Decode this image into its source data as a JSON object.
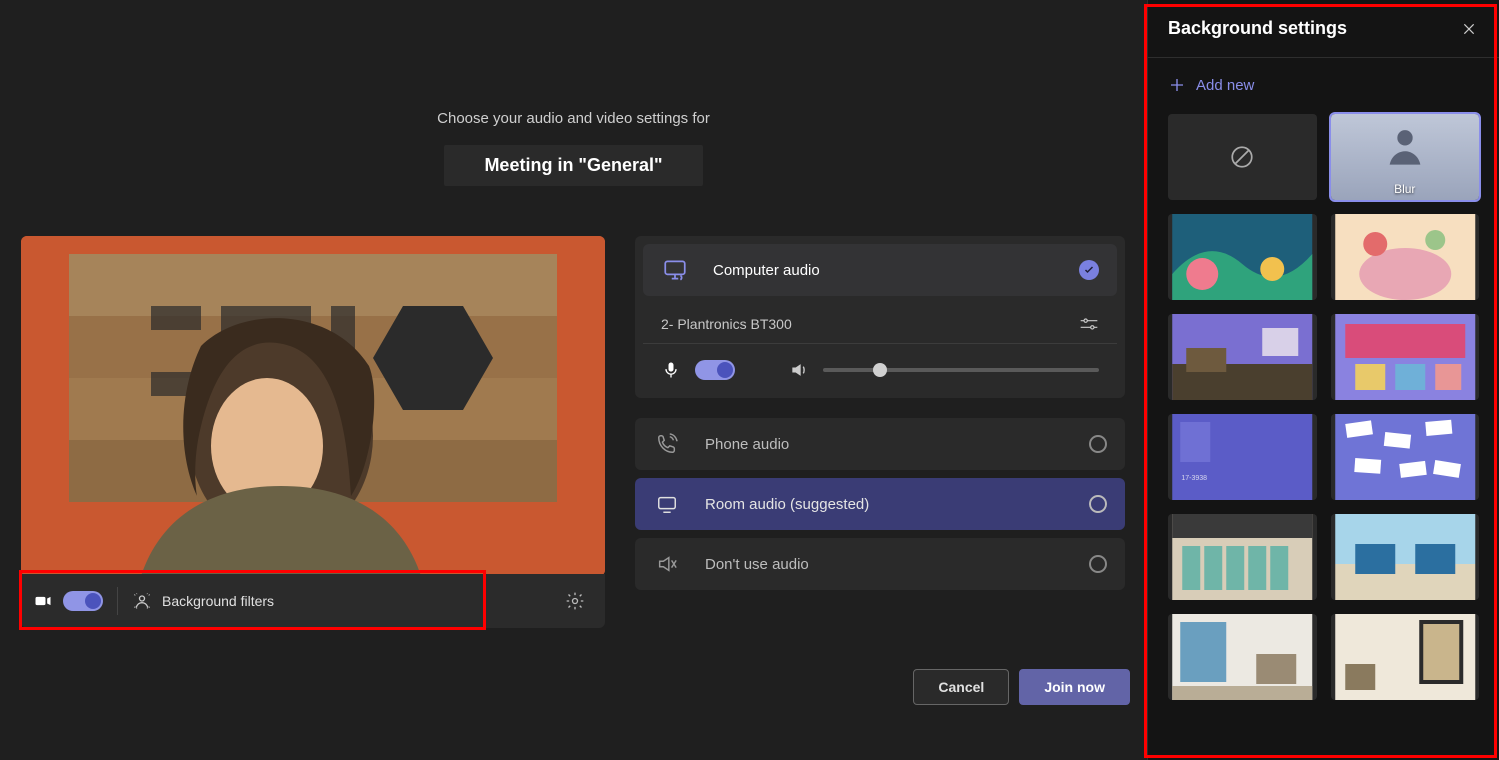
{
  "header": {
    "subtitle": "Choose your audio and video settings for",
    "title": "Meeting in \"General\""
  },
  "videoControls": {
    "backgroundFiltersLabel": "Background filters"
  },
  "audio": {
    "computerAudio": "Computer audio",
    "device": "2- Plantronics BT300",
    "phone": "Phone audio",
    "room": "Room audio (suggested)",
    "none": "Don't use audio"
  },
  "actions": {
    "cancel": "Cancel",
    "join": "Join now"
  },
  "sidebar": {
    "title": "Background settings",
    "addNew": "Add new",
    "blur": "Blur"
  }
}
